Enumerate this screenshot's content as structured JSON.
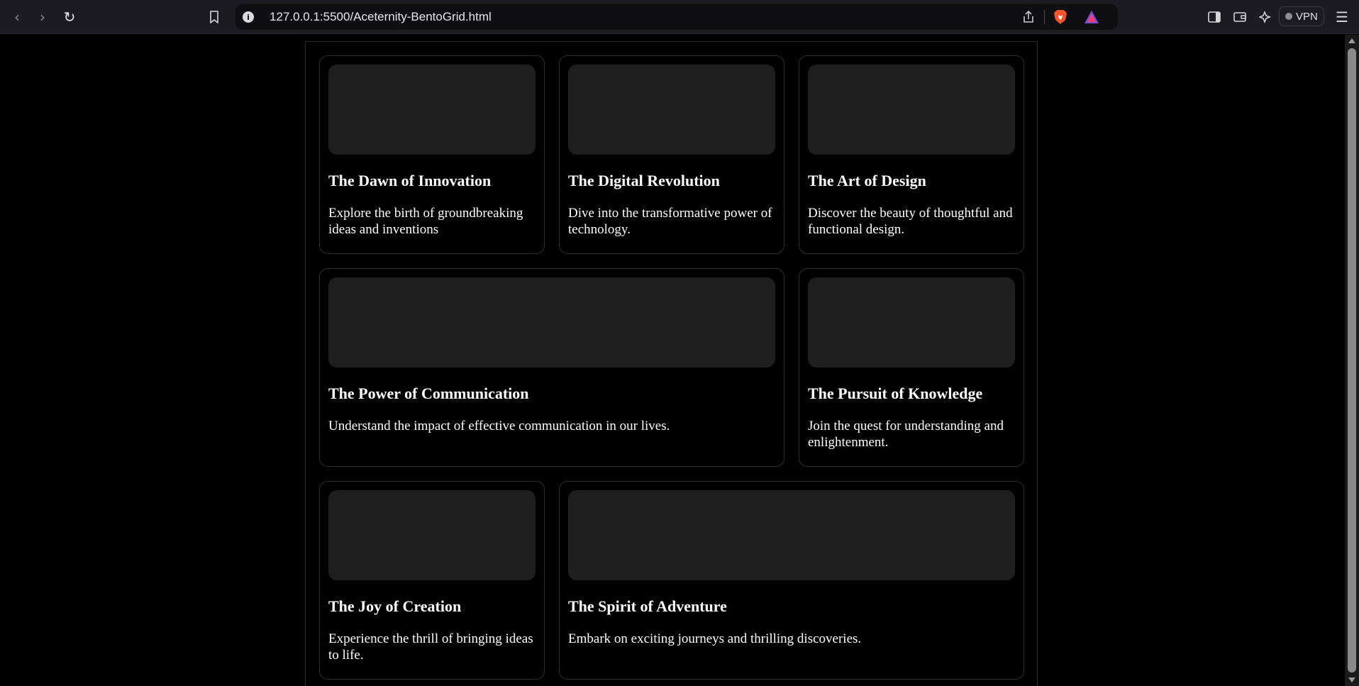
{
  "browser": {
    "url": "127.0.0.1:5500/Aceternity-BentoGrid.html",
    "vpn_label": "VPN"
  },
  "cards": [
    {
      "title": "The Dawn of Innovation",
      "description": "Explore the birth of groundbreaking ideas and inventions"
    },
    {
      "title": "The Digital Revolution",
      "description": "Dive into the transformative power of technology."
    },
    {
      "title": "The Art of Design",
      "description": "Discover the beauty of thoughtful and functional design."
    },
    {
      "title": "The Power of Communication",
      "description": "Understand the impact of effective communication in our lives."
    },
    {
      "title": "The Pursuit of Knowledge",
      "description": "Join the quest for understanding and enlightenment."
    },
    {
      "title": "The Joy of Creation",
      "description": "Experience the thrill of bringing ideas to life."
    },
    {
      "title": "The Spirit of Adventure",
      "description": "Embark on exciting journeys and thrilling discoveries."
    }
  ],
  "colors": {
    "page_bg": "#000000",
    "card_border": "#2e2e2e",
    "thumb_bg": "#1e1e1e",
    "text": "#ffffff"
  }
}
